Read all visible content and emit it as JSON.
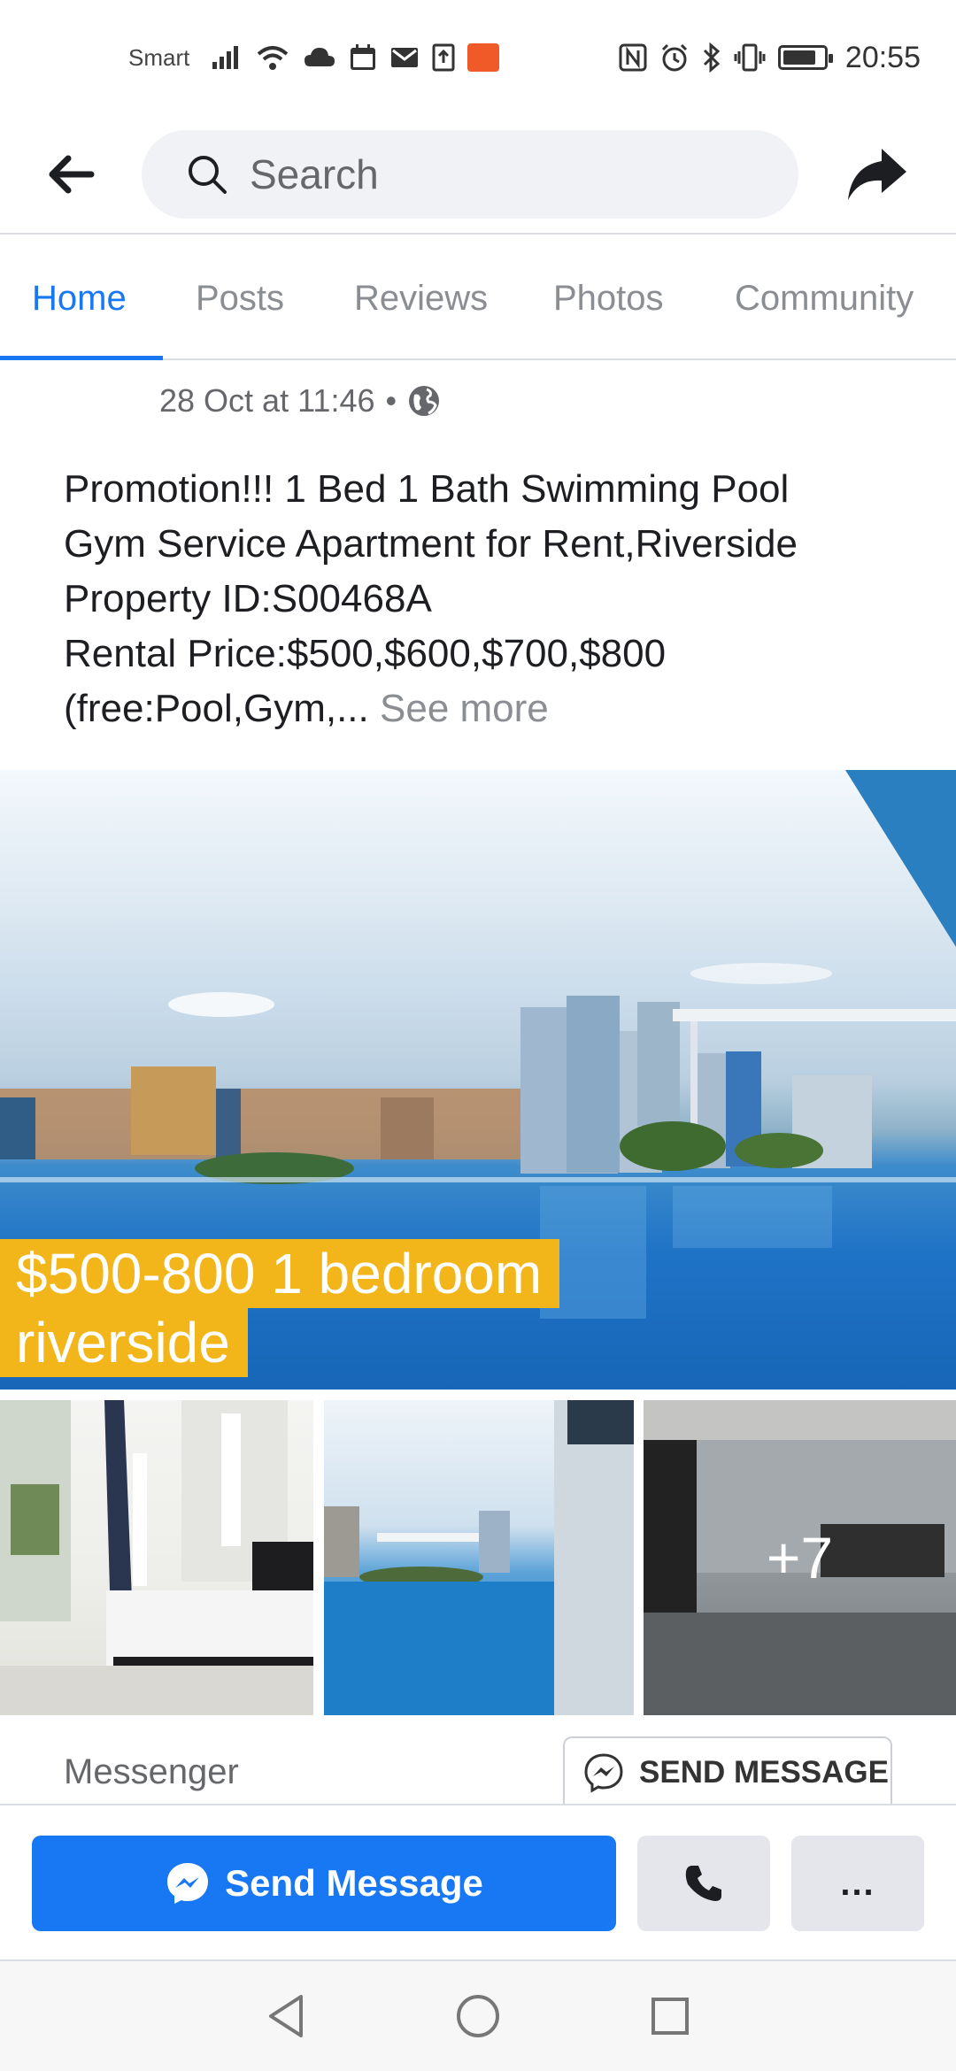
{
  "status_bar": {
    "carrier": "Smart",
    "time": "20:55",
    "battery_level": 0.85,
    "icons": [
      "signal-icon",
      "wifi-icon",
      "cloud-icon",
      "calendar-icon",
      "mail-icon",
      "upload-icon",
      "app-notification-icon",
      "nfc-icon",
      "alarm-icon",
      "bluetooth-icon",
      "vibrate-icon",
      "battery-icon"
    ]
  },
  "header": {
    "back_icon": "arrow-left-icon",
    "search_placeholder": "Search",
    "share_icon": "share-icon"
  },
  "tabs": [
    {
      "label": "Home",
      "active": true
    },
    {
      "label": "Posts",
      "active": false
    },
    {
      "label": "Reviews",
      "active": false
    },
    {
      "label": "Photos",
      "active": false
    },
    {
      "label": "Community",
      "active": false
    }
  ],
  "post": {
    "timestamp": "28 Oct at 11:46",
    "separator": "•",
    "visibility_icon": "globe-icon",
    "text_lines": [
      "Promotion!!! 1 Bed 1 Bath Swimming Pool",
      "Gym Service Apartment for Rent,Riverside",
      "Property ID:S00468A",
      "Rental Price:$500,$600,$700,$800",
      "(free:Pool,Gym,..."
    ],
    "see_more": "See more",
    "photo_caption_line1": "$500-800 1 bedroom",
    "photo_caption_line2": "riverside",
    "more_photos_count": "+7"
  },
  "messenger": {
    "label": "Messenger",
    "button_label": "SEND MESSAGE"
  },
  "action_bar": {
    "send_message": "Send Message",
    "call_icon": "phone-icon",
    "more_label": "..."
  },
  "colors": {
    "accent": "#1877f2",
    "caption_bg": "#f2b61a"
  }
}
